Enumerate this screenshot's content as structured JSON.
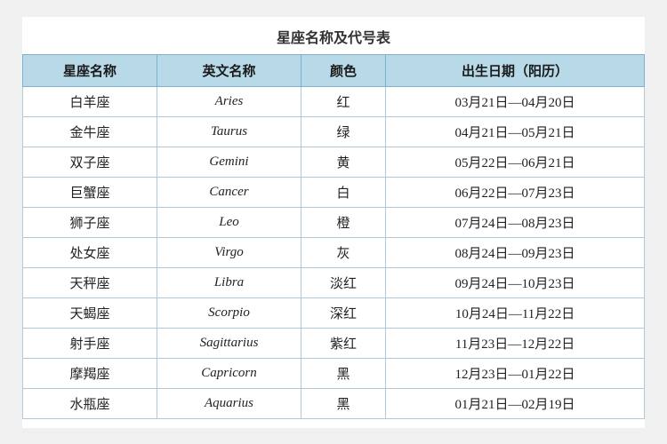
{
  "title": "星座名称及代号表",
  "headers": [
    "星座名称",
    "英文名称",
    "颜色",
    "出生日期（阳历）"
  ],
  "rows": [
    {
      "chinese": "白羊座",
      "english": "Aries",
      "color": "红",
      "dates": "03月21日—04月20日"
    },
    {
      "chinese": "金牛座",
      "english": "Taurus",
      "color": "绿",
      "dates": "04月21日—05月21日"
    },
    {
      "chinese": "双子座",
      "english": "Gemini",
      "color": "黄",
      "dates": "05月22日—06月21日"
    },
    {
      "chinese": "巨蟹座",
      "english": "Cancer",
      "color": "白",
      "dates": "06月22日—07月23日"
    },
    {
      "chinese": "狮子座",
      "english": "Leo",
      "color": "橙",
      "dates": "07月24日—08月23日"
    },
    {
      "chinese": "处女座",
      "english": "Virgo",
      "color": "灰",
      "dates": "08月24日—09月23日"
    },
    {
      "chinese": "天秤座",
      "english": "Libra",
      "color": "淡红",
      "dates": "09月24日—10月23日"
    },
    {
      "chinese": "天蝎座",
      "english": "Scorpio",
      "color": "深红",
      "dates": "10月24日—11月22日"
    },
    {
      "chinese": "射手座",
      "english": "Sagittarius",
      "color": "紫红",
      "dates": "11月23日—12月22日"
    },
    {
      "chinese": "摩羯座",
      "english": "Capricorn",
      "color": "黑",
      "dates": "12月23日—01月22日"
    },
    {
      "chinese": "水瓶座",
      "english": "Aquarius",
      "color": "黑",
      "dates": "01月21日—02月19日"
    }
  ]
}
